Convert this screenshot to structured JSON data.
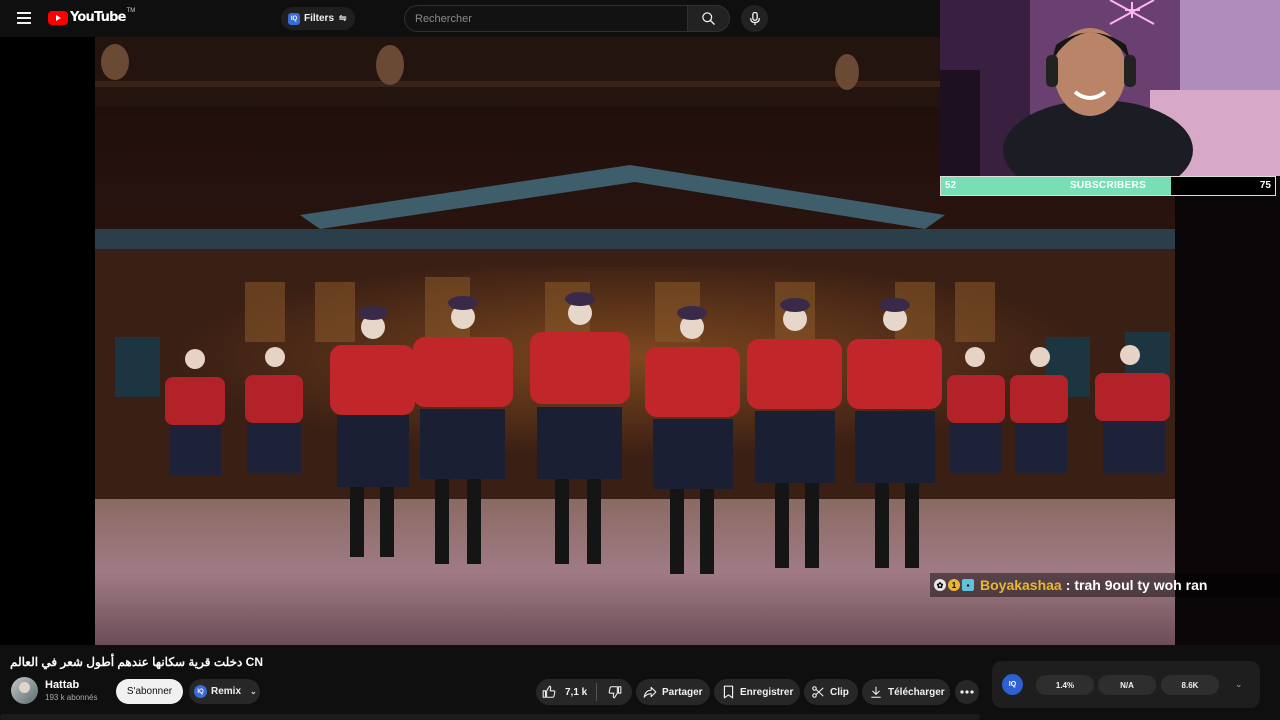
{
  "topbar": {
    "logo_text": "YouTube",
    "logo_tm": "TM",
    "filters_label": "Filters",
    "filters_badge": "IQ",
    "search_placeholder": "Rechercher"
  },
  "overlay": {
    "subscribers_label": "SUBSCRIBERS",
    "subscribers_current": "52",
    "subscribers_goal": "75",
    "subscribers_progress": 0.69,
    "bar_color": "#77dfb3",
    "chat_user": "Boyakashaa",
    "chat_separator": ":",
    "chat_message": "trah 9oul ty woh ran"
  },
  "video": {
    "title": "دخلت قرية سكانها عندهم أطول شعر في العالم CN"
  },
  "channel": {
    "name": "Hattab",
    "subscribers": "193 k abonnés",
    "subscribe_label": "S'abonner",
    "remix_label": "Remix",
    "remix_badge": "IQ"
  },
  "actions": {
    "like_count": "7,1 k",
    "share_label": "Partager",
    "save_label": "Enregistrer",
    "clip_label": "Clip",
    "download_label": "Télécharger"
  },
  "stats": {
    "badge": "IQ",
    "stat1": "1.4%",
    "stat2": "N/A",
    "stat3": "8.6K"
  },
  "colors": {
    "accent": "#ff0000",
    "chat_user": "#e9b634",
    "iq_blue": "#2f5fd0"
  }
}
